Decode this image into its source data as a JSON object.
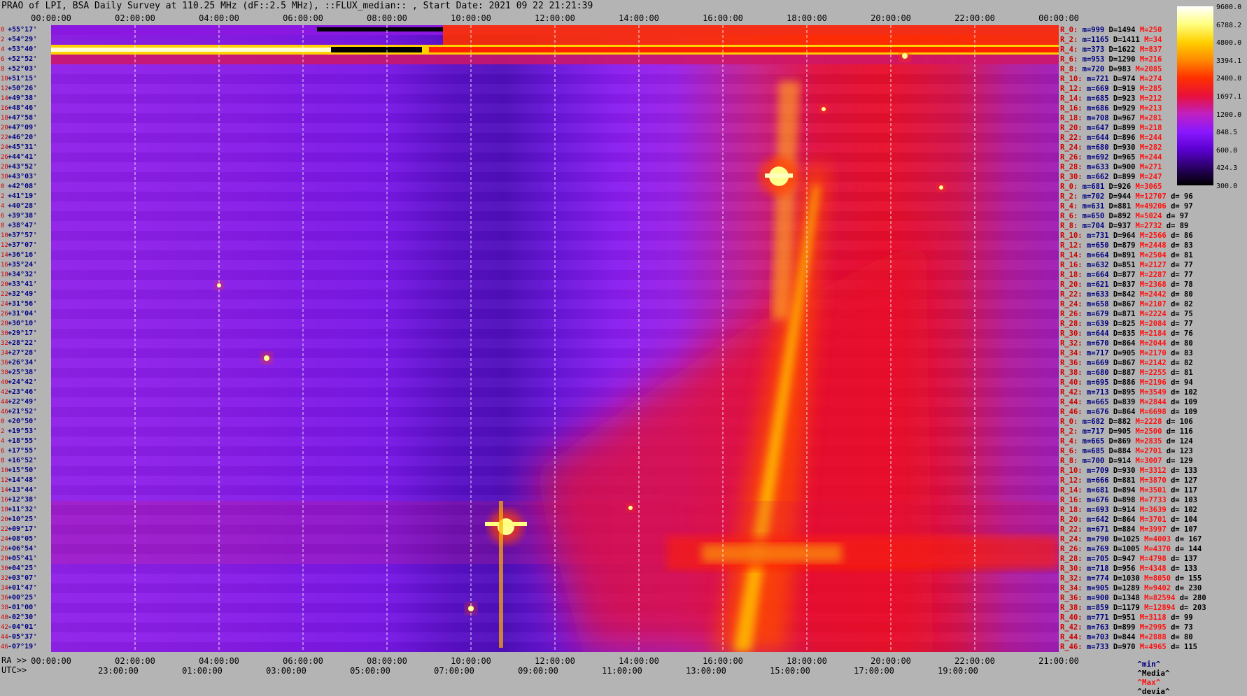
{
  "title": "PRAO of LPI, BSA Daily Survey at 110.25 MHz (dF::2.5 MHz), ::FLUX_median:: , Start Date: 2021 09 22 21:21:39",
  "chart_data": {
    "type": "heatmap",
    "title": "PRAO of LPI, BSA Daily Survey at 110.25 MHz (dF::2.5 MHz), ::FLUX_median:: , Start Date: 2021 09 22 21:21:39",
    "top_ticks": [
      "00:00:00",
      "02:00:00",
      "04:00:00",
      "06:00:00",
      "08:00:00",
      "10:00:00",
      "12:00:00",
      "14:00:00",
      "16:00:00",
      "18:00:00",
      "20:00:00",
      "22:00:00",
      "00:00:00"
    ],
    "ra_ticks": [
      "00:00:00",
      "02:00:00",
      "04:00:00",
      "06:00:00",
      "08:00:00",
      "10:00:00",
      "12:00:00",
      "14:00:00",
      "16:00:00",
      "18:00:00",
      "20:00:00",
      "22:00:00",
      "21:00:00"
    ],
    "utc_ticks": [
      "23:00:00",
      "01:00:00",
      "03:00:00",
      "05:00:00",
      "07:00:00",
      "09:00:00",
      "11:00:00",
      "13:00:00",
      "15:00:00",
      "17:00:00",
      "19:00:00"
    ],
    "ra_prefix": "RA >>",
    "utc_prefix": "UTC>>",
    "colorbar": {
      "labels": [
        "9600.0",
        "6788.2",
        "4800.0",
        "3394.1",
        "2400.0",
        "1697.1",
        "1200.0",
        "848.5",
        "600.0",
        "424.3",
        "300.0"
      ],
      "range": [
        300,
        9600
      ],
      "scale": "log",
      "colors": [
        "#000000",
        "#2a0066",
        "#5a00d0",
        "#8a18ff",
        "#c020c0",
        "#e8103a",
        "#ff3000",
        "#ff8a00",
        "#ffd000",
        "#ffff80",
        "#ffffff"
      ]
    },
    "declinations": [
      "+55°17'",
      "+54°29'",
      "+53°40'",
      "+52°52'",
      "+52°03'",
      "+51°15'",
      "+50°26'",
      "+49°38'",
      "+48°46'",
      "+47°58'",
      "+47°09'",
      "+46°20'",
      "+45°31'",
      "+44°41'",
      "+43°52'",
      "+43°03'",
      "+42°08'",
      "+41°19'",
      "+40°28'",
      "+39°38'",
      "+38°47'",
      "+37°57'",
      "+37°07'",
      "+36°16'",
      "+35°24'",
      "+34°32'",
      "+33°41'",
      "+32°49'",
      "+31°56'",
      "+31°04'",
      "+30°10'",
      "+29°17'",
      "+28°22'",
      "+27°28'",
      "+26°34'",
      "+25°38'",
      "+24°42'",
      "+23°46'",
      "+22°49'",
      "+21°52'",
      "+20°50'",
      "+19°53'",
      "+18°55'",
      "+17°55'",
      "+16°52'",
      "+15°50'",
      "+14°48'",
      "+13°44'",
      "+12°38'",
      "+11°32'",
      "+10°25'",
      "+09°17'",
      "+08°05'",
      "+06°54'",
      "+05°41'",
      "+04°25'",
      "+03°07'",
      "+01°47'",
      "+00°25'",
      "-01°00'",
      "-02°30'",
      "-04°01'",
      "-05°37'",
      "-07°19'"
    ],
    "row_indices": [
      "0",
      "2",
      "4",
      "6",
      "8",
      "10",
      "12",
      "14",
      "16",
      "18",
      "20",
      "22",
      "24",
      "26",
      "28",
      "30",
      "0",
      "2",
      "4",
      "6",
      "8",
      "10",
      "12",
      "14",
      "16",
      "18",
      "20",
      "22",
      "24",
      "26",
      "28",
      "30",
      "32",
      "34",
      "36",
      "38",
      "40",
      "42",
      "44",
      "46",
      "0",
      "2",
      "4",
      "6",
      "8",
      "10",
      "12",
      "14",
      "16",
      "18",
      "20",
      "22",
      "24",
      "26",
      "28",
      "30",
      "32",
      "34",
      "36",
      "38",
      "40",
      "42",
      "44",
      "46"
    ],
    "stats": [
      {
        "r": "R_0:",
        "m": "m=999",
        "d": "D=1494",
        "x": "M=250",
        "dv": ""
      },
      {
        "r": "R_2:",
        "m": "m=1165",
        "d": "D=1411",
        "x": "M=34",
        "dv": ""
      },
      {
        "r": "R_4:",
        "m": "m=373",
        "d": "D=1622",
        "x": "M=837",
        "dv": ""
      },
      {
        "r": "R_6:",
        "m": "m=953",
        "d": "D=1290",
        "x": "M=216",
        "dv": ""
      },
      {
        "r": "R_8:",
        "m": "m=720",
        "d": "D=983",
        "x": "M=2085",
        "dv": ""
      },
      {
        "r": "R_10:",
        "m": "m=721",
        "d": "D=974",
        "x": "M=274",
        "dv": ""
      },
      {
        "r": "R_12:",
        "m": "m=669",
        "d": "D=919",
        "x": "M=285",
        "dv": ""
      },
      {
        "r": "R_14:",
        "m": "m=685",
        "d": "D=923",
        "x": "M=212",
        "dv": ""
      },
      {
        "r": "R_16:",
        "m": "m=686",
        "d": "D=929",
        "x": "M=213",
        "dv": ""
      },
      {
        "r": "R_18:",
        "m": "m=708",
        "d": "D=967",
        "x": "M=281",
        "dv": ""
      },
      {
        "r": "R_20:",
        "m": "m=647",
        "d": "D=899",
        "x": "M=218",
        "dv": ""
      },
      {
        "r": "R_22:",
        "m": "m=644",
        "d": "D=896",
        "x": "M=244",
        "dv": ""
      },
      {
        "r": "R_24:",
        "m": "m=680",
        "d": "D=930",
        "x": "M=282",
        "dv": ""
      },
      {
        "r": "R_26:",
        "m": "m=692",
        "d": "D=965",
        "x": "M=244",
        "dv": ""
      },
      {
        "r": "R_28:",
        "m": "m=633",
        "d": "D=900",
        "x": "M=271",
        "dv": ""
      },
      {
        "r": "R_30:",
        "m": "m=662",
        "d": "D=899",
        "x": "M=247",
        "dv": ""
      },
      {
        "r": "R_0:",
        "m": "m=681",
        "d": "D=926",
        "x": "M=3065",
        "dv": ""
      },
      {
        "r": "R_2:",
        "m": "m=702",
        "d": "D=944",
        "x": "M=12707",
        "dv": "d= 96"
      },
      {
        "r": "R_4:",
        "m": "m=631",
        "d": "D=881",
        "x": "M=49206",
        "dv": "d= 97"
      },
      {
        "r": "R_6:",
        "m": "m=650",
        "d": "D=892",
        "x": "M=5024",
        "dv": "d= 97"
      },
      {
        "r": "R_8:",
        "m": "m=704",
        "d": "D=937",
        "x": "M=2732",
        "dv": "d= 89"
      },
      {
        "r": "R_10:",
        "m": "m=731",
        "d": "D=964",
        "x": "M=2566",
        "dv": "d= 86"
      },
      {
        "r": "R_12:",
        "m": "m=650",
        "d": "D=879",
        "x": "M=2448",
        "dv": "d= 83"
      },
      {
        "r": "R_14:",
        "m": "m=664",
        "d": "D=891",
        "x": "M=2504",
        "dv": "d= 81"
      },
      {
        "r": "R_16:",
        "m": "m=632",
        "d": "D=851",
        "x": "M=2127",
        "dv": "d= 77"
      },
      {
        "r": "R_18:",
        "m": "m=664",
        "d": "D=877",
        "x": "M=2287",
        "dv": "d= 77"
      },
      {
        "r": "R_20:",
        "m": "m=621",
        "d": "D=837",
        "x": "M=2368",
        "dv": "d= 78"
      },
      {
        "r": "R_22:",
        "m": "m=633",
        "d": "D=842",
        "x": "M=2442",
        "dv": "d= 80"
      },
      {
        "r": "R_24:",
        "m": "m=658",
        "d": "D=867",
        "x": "M=2107",
        "dv": "d= 82"
      },
      {
        "r": "R_26:",
        "m": "m=679",
        "d": "D=871",
        "x": "M=2224",
        "dv": "d= 75"
      },
      {
        "r": "R_28:",
        "m": "m=639",
        "d": "D=825",
        "x": "M=2084",
        "dv": "d= 77"
      },
      {
        "r": "R_30:",
        "m": "m=644",
        "d": "D=835",
        "x": "M=2184",
        "dv": "d= 76"
      },
      {
        "r": "R_32:",
        "m": "m=670",
        "d": "D=864",
        "x": "M=2044",
        "dv": "d= 80"
      },
      {
        "r": "R_34:",
        "m": "m=717",
        "d": "D=905",
        "x": "M=2170",
        "dv": "d= 83"
      },
      {
        "r": "R_36:",
        "m": "m=669",
        "d": "D=867",
        "x": "M=2142",
        "dv": "d= 82"
      },
      {
        "r": "R_38:",
        "m": "m=680",
        "d": "D=887",
        "x": "M=2255",
        "dv": "d= 81"
      },
      {
        "r": "R_40:",
        "m": "m=695",
        "d": "D=886",
        "x": "M=2196",
        "dv": "d= 94"
      },
      {
        "r": "R_42:",
        "m": "m=713",
        "d": "D=895",
        "x": "M=3549",
        "dv": "d= 102"
      },
      {
        "r": "R_44:",
        "m": "m=665",
        "d": "D=839",
        "x": "M=2844",
        "dv": "d= 109"
      },
      {
        "r": "R_46:",
        "m": "m=676",
        "d": "D=864",
        "x": "M=6698",
        "dv": "d= 109"
      },
      {
        "r": "R_0:",
        "m": "m=682",
        "d": "D=882",
        "x": "M=2228",
        "dv": "d= 106"
      },
      {
        "r": "R_2:",
        "m": "m=717",
        "d": "D=905",
        "x": "M=2500",
        "dv": "d= 116"
      },
      {
        "r": "R_4:",
        "m": "m=665",
        "d": "D=869",
        "x": "M=2835",
        "dv": "d= 124"
      },
      {
        "r": "R_6:",
        "m": "m=685",
        "d": "D=884",
        "x": "M=2701",
        "dv": "d= 123"
      },
      {
        "r": "R_8:",
        "m": "m=700",
        "d": "D=914",
        "x": "M=3007",
        "dv": "d= 129"
      },
      {
        "r": "R_10:",
        "m": "m=709",
        "d": "D=930",
        "x": "M=3312",
        "dv": "d= 133"
      },
      {
        "r": "R_12:",
        "m": "m=666",
        "d": "D=881",
        "x": "M=3870",
        "dv": "d= 127"
      },
      {
        "r": "R_14:",
        "m": "m=681",
        "d": "D=894",
        "x": "M=3501",
        "dv": "d= 117"
      },
      {
        "r": "R_16:",
        "m": "m=676",
        "d": "D=898",
        "x": "M=7733",
        "dv": "d= 103"
      },
      {
        "r": "R_18:",
        "m": "m=693",
        "d": "D=914",
        "x": "M=3639",
        "dv": "d= 102"
      },
      {
        "r": "R_20:",
        "m": "m=642",
        "d": "D=864",
        "x": "M=3701",
        "dv": "d= 104"
      },
      {
        "r": "R_22:",
        "m": "m=671",
        "d": "D=884",
        "x": "M=3997",
        "dv": "d= 107"
      },
      {
        "r": "R_24:",
        "m": "m=790",
        "d": "D=1025",
        "x": "M=4003",
        "dv": "d= 167"
      },
      {
        "r": "R_26:",
        "m": "m=769",
        "d": "D=1005",
        "x": "M=4370",
        "dv": "d= 144"
      },
      {
        "r": "R_28:",
        "m": "m=705",
        "d": "D=947",
        "x": "M=4798",
        "dv": "d= 137"
      },
      {
        "r": "R_30:",
        "m": "m=718",
        "d": "D=956",
        "x": "M=4348",
        "dv": "d= 133"
      },
      {
        "r": "R_32:",
        "m": "m=774",
        "d": "D=1030",
        "x": "M=8050",
        "dv": "d= 155"
      },
      {
        "r": "R_34:",
        "m": "m=905",
        "d": "D=1289",
        "x": "M=9402",
        "dv": "d= 230"
      },
      {
        "r": "R_36:",
        "m": "m=900",
        "d": "D=1348",
        "x": "M=82594",
        "dv": "d= 280"
      },
      {
        "r": "R_38:",
        "m": "m=859",
        "d": "D=1179",
        "x": "M=12894",
        "dv": "d= 203"
      },
      {
        "r": "R_40:",
        "m": "m=771",
        "d": "D=951",
        "x": "M=3118",
        "dv": "d= 99"
      },
      {
        "r": "R_42:",
        "m": "m=763",
        "d": "D=899",
        "x": "M=2995",
        "dv": "d= 73"
      },
      {
        "r": "R_44:",
        "m": "m=703",
        "d": "D=844",
        "x": "M=2888",
        "dv": "d= 80"
      },
      {
        "r": "R_46:",
        "m": "m=733",
        "d": "D=970",
        "x": "M=4965",
        "dv": "d= 115"
      }
    ],
    "legend": {
      "min": "^min^",
      "median": "^Media^",
      "max": "^Max^",
      "devia": "^devia^"
    }
  }
}
